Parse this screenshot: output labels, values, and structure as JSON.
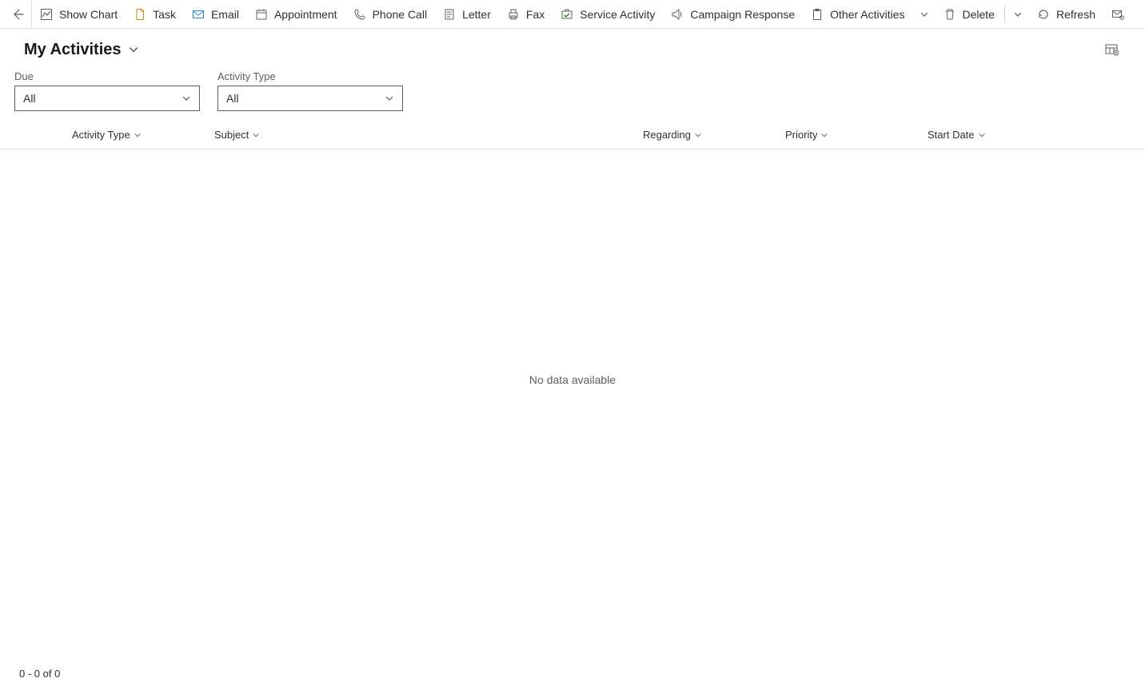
{
  "commandBar": {
    "showChart": "Show Chart",
    "task": "Task",
    "email": "Email",
    "appointment": "Appointment",
    "phoneCall": "Phone Call",
    "letter": "Letter",
    "fax": "Fax",
    "serviceActivity": "Service Activity",
    "campaignResponse": "Campaign Response",
    "otherActivities": "Other Activities",
    "delete": "Delete",
    "refresh": "Refresh"
  },
  "view": {
    "title": "My Activities"
  },
  "filters": {
    "due": {
      "label": "Due",
      "value": "All"
    },
    "activityType": {
      "label": "Activity Type",
      "value": "All"
    }
  },
  "columns": {
    "activityType": "Activity Type",
    "subject": "Subject",
    "regarding": "Regarding",
    "priority": "Priority",
    "startDate": "Start Date"
  },
  "grid": {
    "noData": "No data available"
  },
  "footer": {
    "paging": "0 - 0 of 0"
  }
}
